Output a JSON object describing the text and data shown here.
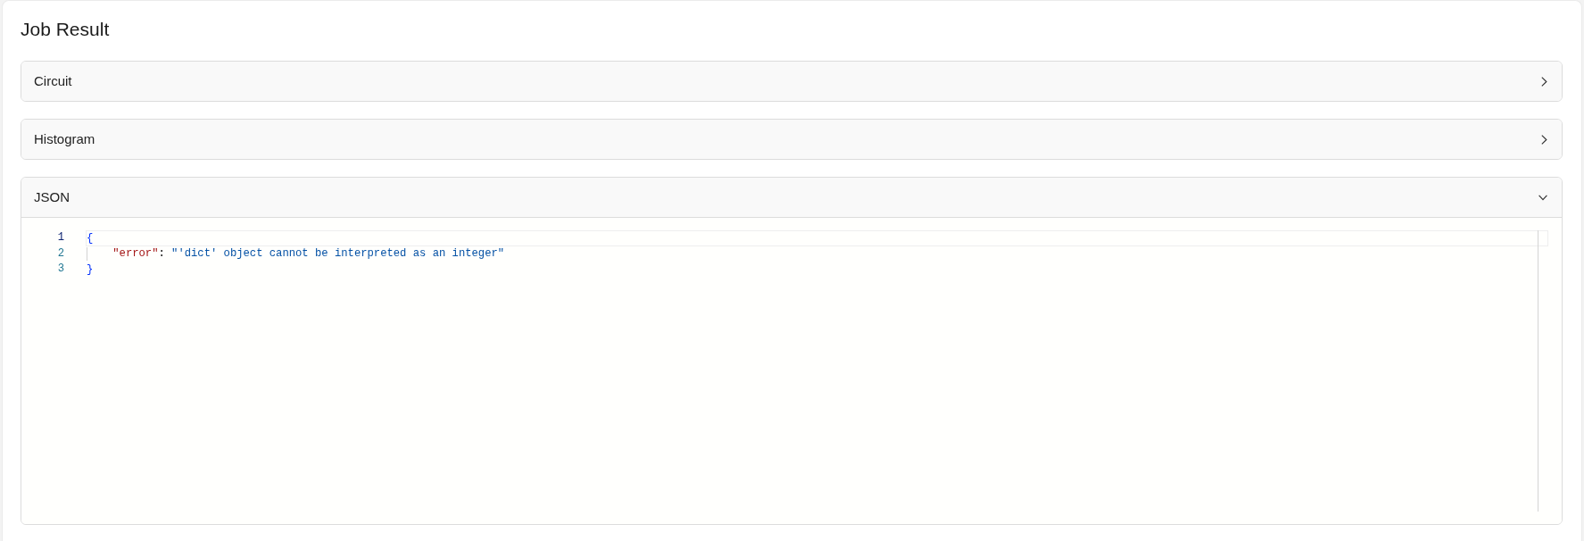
{
  "title": "Job Result",
  "sections": [
    {
      "label": "Circuit",
      "expanded": false
    },
    {
      "label": "Histogram",
      "expanded": false
    },
    {
      "label": "JSON",
      "expanded": true,
      "editor": {
        "lines": [
          {
            "number": "1",
            "current": true,
            "tokens": [
              {
                "kind": "bracket",
                "text": "{"
              }
            ],
            "children": [
              {
                "number": "2",
                "current": false,
                "tokens": [
                  {
                    "kind": "key",
                    "text": "\"error\""
                  },
                  {
                    "kind": "punctuation",
                    "text": ":"
                  },
                  {
                    "kind": "string",
                    "text": "\"'dict' object cannot be interpreted as an integer\""
                  }
                ]
              }
            ]
          },
          {
            "number": "3",
            "current": false,
            "tokens": [
              {
                "kind": "bracket",
                "text": "}"
              }
            ]
          }
        ]
      }
    }
  ]
}
